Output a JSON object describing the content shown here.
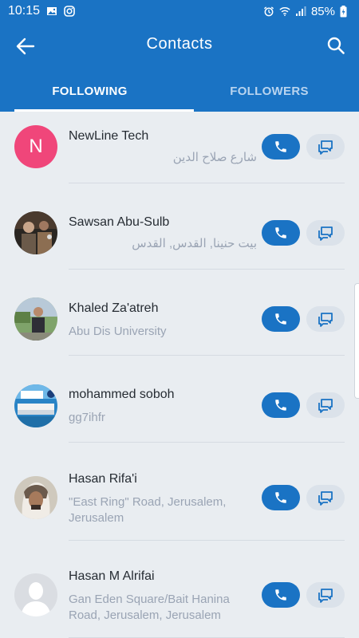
{
  "status": {
    "time": "10:15",
    "battery": "85%"
  },
  "header": {
    "title": "Contacts"
  },
  "tabs": [
    {
      "label": "FOLLOWING",
      "active": true
    },
    {
      "label": "FOLLOWERS",
      "active": false
    }
  ],
  "contacts": [
    {
      "name": "NewLine Tech",
      "subtitle": "شارع صلاح الدين",
      "rtl": true,
      "avatar": "letter",
      "avatar_letter": "N"
    },
    {
      "name": "Sawsan Abu-Sulb",
      "subtitle": "بيت حنينا, القدس, القدس",
      "rtl": true,
      "avatar": "photo"
    },
    {
      "name": "Khaled Za'atreh",
      "subtitle": "Abu Dis University",
      "rtl": false,
      "avatar": "photo"
    },
    {
      "name": "mohammed soboh",
      "subtitle": "gg7ihfr",
      "rtl": false,
      "avatar": "photo"
    },
    {
      "name": "Hasan Rifa'i",
      "subtitle": "\"East Ring\" Road, Jerusalem, Jerusalem",
      "rtl": false,
      "avatar": "photo"
    },
    {
      "name": "Hasan M Alrifai",
      "subtitle": "Gan Eden Square/Bait Hanina Road, Jerusalem, Jerusalem",
      "rtl": false,
      "avatar": "placeholder"
    }
  ],
  "colors": {
    "primary": "#1a73c4",
    "avatar_letter_bg": "#f0467a",
    "background": "#e9edf1"
  }
}
